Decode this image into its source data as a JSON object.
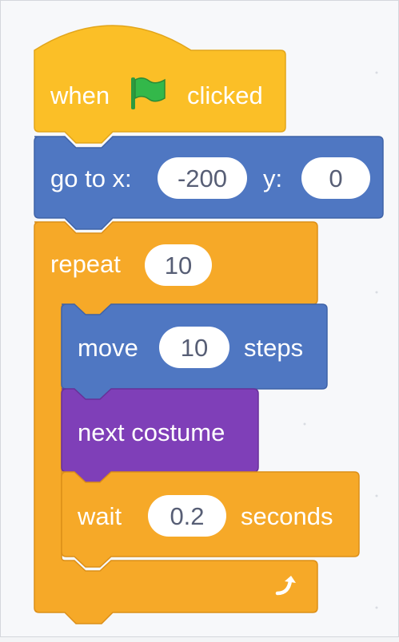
{
  "script": {
    "hat_block": {
      "word1": "when",
      "flag_icon": "green-flag-icon",
      "word2": "clicked"
    },
    "goto_block": {
      "x_label": "go to x:",
      "x_value": "-200",
      "y_label": "y:",
      "y_value": "0"
    },
    "repeat_block": {
      "label": "repeat",
      "count": "10",
      "loop_icon": "repeat-arrow-icon"
    },
    "move_block": {
      "label": "move",
      "steps_value": "10",
      "unit": "steps"
    },
    "costume_block": {
      "label": "next costume"
    },
    "wait_block": {
      "label": "wait",
      "seconds_value": "0.2",
      "unit": "seconds"
    }
  },
  "colors": {
    "events": "#fbbf27",
    "events_border": "#e2a51a",
    "motion": "#4f77c2",
    "motion_border": "#3f63a8",
    "control": "#f6a928",
    "control_border": "#dc8f18",
    "looks": "#7f3fb8",
    "looks_border": "#683199",
    "input_text": "#575e75",
    "flag_green": "#33b84a"
  }
}
